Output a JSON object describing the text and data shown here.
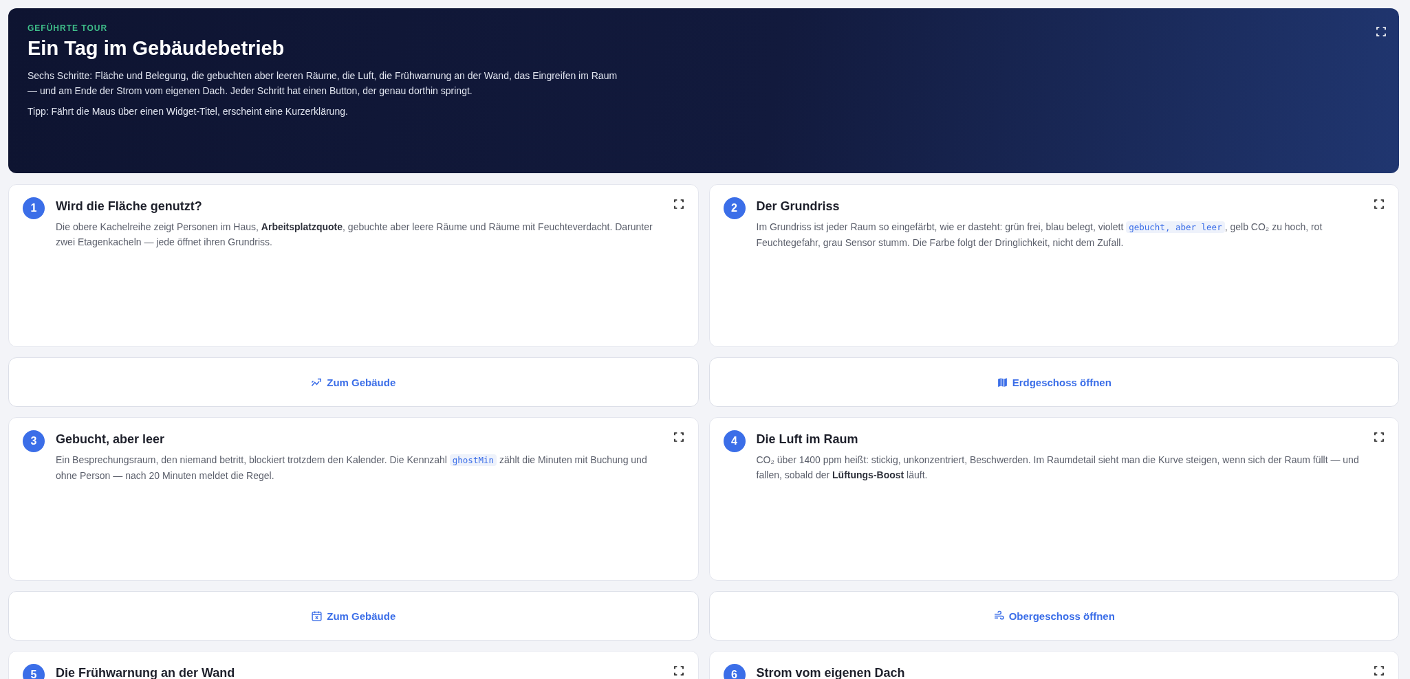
{
  "hero": {
    "eyebrow": "GEFÜHRTE TOUR",
    "title": "Ein Tag im Gebäudebetrieb",
    "intro": "Sechs Schritte: Fläche und Belegung, die gebuchten aber leeren Räume, die Luft, die Frühwarnung an der Wand, das Eingreifen im Raum — und am Ende der Strom vom eigenen Dach. Jeder Schritt hat einen Button, der genau dorthin springt.",
    "tip": "Tipp: Fährt die Maus über einen Widget-Titel, erscheint eine Kurzerklärung."
  },
  "steps": [
    {
      "number": "1",
      "title": "Wird die Fläche genutzt?",
      "body": [
        {
          "kind": "text",
          "text": "Die obere Kachelreihe zeigt Personen im Haus, **Arbeitsplatzquote**, gebuchte aber leere Räume und Räume mit Feuchteverdacht. Darunter zwei Etagenkacheln — jede öffnet ihren Grundriss."
        }
      ],
      "button": "Zum Gebäude"
    },
    {
      "number": "2",
      "title": "Der Grundriss",
      "body": [
        {
          "kind": "text",
          "text": "Im Grundriss ist jeder Raum so eingefärbt, wie er dasteht: grün frei, blau belegt, violett "
        },
        {
          "kind": "code",
          "text": "gebucht, aber leer"
        },
        {
          "kind": "text",
          "text": ", gelb CO₂ zu hoch, rot Feuchtegefahr, grau Sensor stumm. Die Farbe folgt der Dringlichkeit, nicht dem Zufall."
        }
      ],
      "button": "Erdgeschoss öffnen"
    },
    {
      "number": "3",
      "title": "Gebucht, aber leer",
      "body": [
        {
          "kind": "text",
          "text": "Ein Besprechungsraum, den niemand betritt, blockiert trotzdem den Kalender. Die Kennzahl "
        },
        {
          "kind": "code",
          "text": "ghostMin"
        },
        {
          "kind": "text",
          "text": " zählt die Minuten mit Buchung und ohne Person — nach 20 Minuten meldet die Regel."
        }
      ],
      "button": "Zum Gebäude"
    },
    {
      "number": "4",
      "title": "Die Luft im Raum",
      "body": [
        {
          "kind": "text",
          "text": "CO₂ über 1400 ppm heißt: stickig, unkonzentriert, Beschwerden. Im Raumdetail sieht man die Kurve steigen, wenn sich der Raum füllt — und fallen, sobald der **Lüftungs-Boost** läuft."
        }
      ],
      "button": "Obergeschoss öffnen"
    },
    {
      "number": "5",
      "title": "Die Frühwarnung an der Wand"
    },
    {
      "number": "6",
      "title": "Strom vom eigenen Dach"
    }
  ]
}
